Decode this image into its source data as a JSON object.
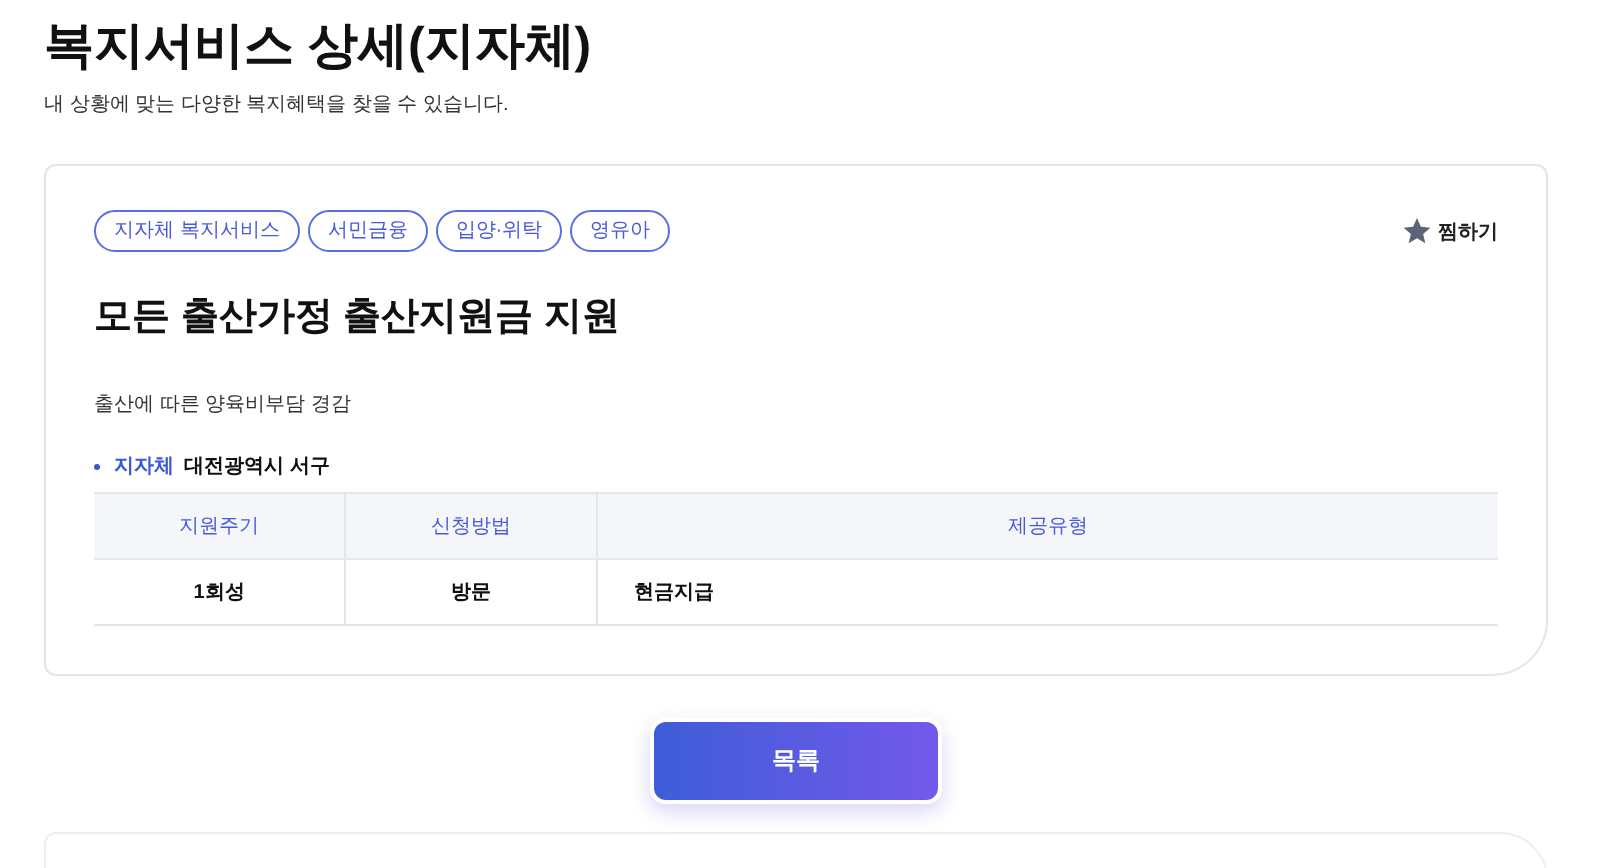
{
  "page": {
    "title": "복지서비스 상세(지자체)",
    "subtitle": "내 상황에 맞는 다양한 복지혜택을 찾을 수 있습니다."
  },
  "detail": {
    "tags": [
      "지자체 복지서비스",
      "서민금융",
      "입양·위탁",
      "영유아"
    ],
    "favorite": {
      "label": "찜하기"
    },
    "headline": "모든 출산가정 출산지원금 지원",
    "description": "출산에 따른 양육비부담 경감",
    "region": {
      "label": "지자체",
      "value": "대전광역시 서구"
    },
    "table": {
      "columns": [
        "지원주기",
        "신청방법",
        "제공유형"
      ],
      "rows": [
        [
          "1회성",
          "방문",
          "현금지급"
        ]
      ]
    }
  },
  "buttons": [
    "목록"
  ]
}
